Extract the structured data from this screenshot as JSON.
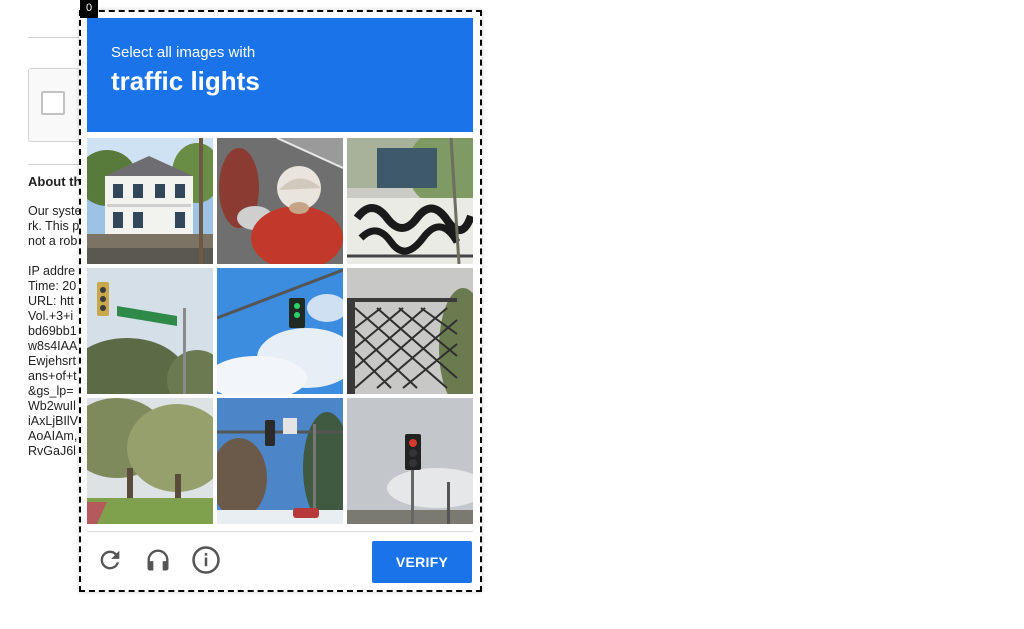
{
  "background_page": {
    "about_title": "About th",
    "about_lines": [
      "Our syste",
      "rk. This p",
      "not a rob",
      "",
      "IP addre",
      "Time: 20",
      "URL: htt",
      "Vol.+3+i",
      "bd69bb1",
      "w8s4IAA",
      "Ewjehsrt",
      "ans+of+t",
      "&gs_lp=",
      "Wb2wuIl",
      "iAxLjBIlV",
      "AoAIAm,",
      "RvGaJ6l"
    ]
  },
  "challenge": {
    "tab_index": "0",
    "instruction_small": "Select all images with",
    "instruction_target": "traffic lights",
    "tiles": [
      {
        "name": "tile-house"
      },
      {
        "name": "tile-scooter-rider"
      },
      {
        "name": "tile-graffiti-wall"
      },
      {
        "name": "tile-street-sign-traffic-light"
      },
      {
        "name": "tile-traffic-light-sky"
      },
      {
        "name": "tile-iron-fence"
      },
      {
        "name": "tile-olive-trees"
      },
      {
        "name": "tile-street-traffic-light"
      },
      {
        "name": "tile-red-traffic-light"
      }
    ],
    "footer": {
      "reload_icon": "reload-icon",
      "audio_icon": "headphones-icon",
      "info_icon": "info-icon",
      "verify_label": "VERIFY"
    }
  },
  "colors": {
    "accent": "#1a73e8"
  }
}
